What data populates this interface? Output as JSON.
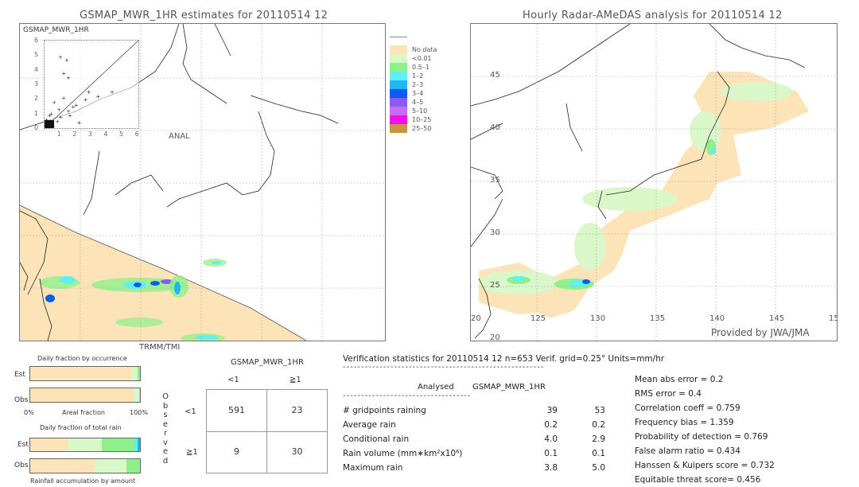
{
  "left_panel": {
    "title": "GSMAP_MWR_1HR estimates for 20110514 12",
    "scatter": {
      "ylabel": "GSMAP_MWR_1HR",
      "xlabel": "ANAL",
      "y_ticks": [
        "6",
        "5",
        "4",
        "3",
        "2",
        "1",
        "0"
      ],
      "x_ticks": [
        "1",
        "2",
        "3",
        "4",
        "5",
        "6"
      ],
      "range": [
        0,
        6
      ]
    },
    "satellite_label": "TRMM/TMI"
  },
  "legend": {
    "items": [
      {
        "label": "",
        "color": "#ffffff"
      },
      {
        "label": "No data",
        "color": "#fde3b8"
      },
      {
        "label": "<0.01",
        "color": "#d9f7c8"
      },
      {
        "label": "0.5–1",
        "color": "#8df08a"
      },
      {
        "label": "1–2",
        "color": "#5ff0f6"
      },
      {
        "label": "2–3",
        "color": "#1eb6f4"
      },
      {
        "label": "3–4",
        "color": "#0a5cf0"
      },
      {
        "label": "4–5",
        "color": "#8a5cf0"
      },
      {
        "label": "5–10",
        "color": "#c86cf0"
      },
      {
        "label": "10–25",
        "color": "#f010e8"
      },
      {
        "label": "25–50",
        "color": "#c8963c"
      }
    ]
  },
  "right_panel": {
    "title": "Hourly Radar-AMeDAS analysis for 20110514 12",
    "lat_ticks": [
      "45",
      "40",
      "35",
      "30",
      "25",
      "20"
    ],
    "lon_ticks": [
      "125",
      "130",
      "135",
      "140",
      "145",
      "15"
    ],
    "lon_start": "20",
    "credit": "Provided by JWA/JMA"
  },
  "occurrence_chart": {
    "title": "Daily fraction by occurrence",
    "rows": [
      {
        "label": "Est",
        "segments": [
          {
            "color": "#fde3b8",
            "fraction": 0.92
          },
          {
            "color": "#d9f7c8",
            "fraction": 0.06
          },
          {
            "color": "#8df08a",
            "fraction": 0.02
          }
        ]
      },
      {
        "label": "Obs",
        "segments": [
          {
            "color": "#fde3b8",
            "fraction": 0.94
          },
          {
            "color": "#d9f7c8",
            "fraction": 0.05
          },
          {
            "color": "#8df08a",
            "fraction": 0.01
          }
        ]
      }
    ],
    "axis_left": "0%",
    "axis_mid": "Areal fraction",
    "axis_right": "100%"
  },
  "total_rain_chart": {
    "title": "Daily fraction of total rain",
    "rows": [
      {
        "label": "Est",
        "segments": [
          {
            "color": "#fde3b8",
            "fraction": 0.34
          },
          {
            "color": "#d9f7c8",
            "fraction": 0.31
          },
          {
            "color": "#8df08a",
            "fraction": 0.3
          },
          {
            "color": "#5ff0f6",
            "fraction": 0.03
          },
          {
            "color": "#1eb6f4",
            "fraction": 0.02
          }
        ]
      },
      {
        "label": "Obs",
        "segments": [
          {
            "color": "#fde3b8",
            "fraction": 0.59
          },
          {
            "color": "#d9f7c8",
            "fraction": 0.29
          },
          {
            "color": "#8df08a",
            "fraction": 0.12
          }
        ]
      }
    ],
    "footer": "Rainfall accumulation by amount"
  },
  "contingency": {
    "header": "GSMAP_MWR_1HR",
    "col_labels": [
      "<1",
      "≧1"
    ],
    "row_labels": [
      "<1",
      "≧1"
    ],
    "side_label": [
      "O",
      "b",
      "s",
      "e",
      "r",
      "v",
      "e",
      "d"
    ],
    "cells": [
      [
        "591",
        "23"
      ],
      [
        "9",
        "30"
      ]
    ]
  },
  "verification": {
    "header": "Verification statistics for 20110514 12   n=653   Verif. grid=0.25°   Units=mm/hr",
    "dashes": "-------------------------------------------------------",
    "col_analysed": "Analysed",
    "col_est": "GSMAP_MWR_1HR",
    "dashes2": "-----------------------------------",
    "rows": [
      {
        "label": "# gridpoints raining",
        "analysed": "39",
        "est": "53"
      },
      {
        "label": "Average rain",
        "analysed": "0.2",
        "est": "0.2"
      },
      {
        "label": "Conditional rain",
        "analysed": "4.0",
        "est": "2.9"
      },
      {
        "label": "Rain volume (mm∗km²x10⁶)",
        "analysed": "0.1",
        "est": "0.1"
      },
      {
        "label": "Maximum rain",
        "analysed": "3.8",
        "est": "5.0"
      }
    ],
    "scores": [
      "Mean abs error = 0.2",
      "RMS error = 0.4",
      "Correlation coeff = 0.759",
      "Frequency bias = 1.359",
      "Probability of detection = 0.769",
      "False alarm ratio = 0.434",
      "Hanssen & Kuipers score = 0.732",
      "Equitable threat score= 0.456"
    ]
  }
}
